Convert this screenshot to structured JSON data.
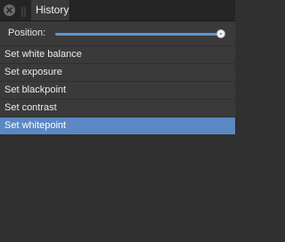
{
  "panel": {
    "tab_title": "History",
    "close_icon": "close-icon",
    "grip_icon": "grip-icon"
  },
  "position": {
    "label": "Position:",
    "value": 1.0
  },
  "history": {
    "items": [
      {
        "label": "Set white balance",
        "selected": false
      },
      {
        "label": "Set exposure",
        "selected": false
      },
      {
        "label": "Set blackpoint",
        "selected": false
      },
      {
        "label": "Set contrast",
        "selected": false
      },
      {
        "label": "Set whitepoint",
        "selected": true
      }
    ]
  },
  "colors": {
    "accent": "#5b88c4",
    "panel_bg": "#2f2f2f",
    "row_bg": "#3a3a3a"
  }
}
